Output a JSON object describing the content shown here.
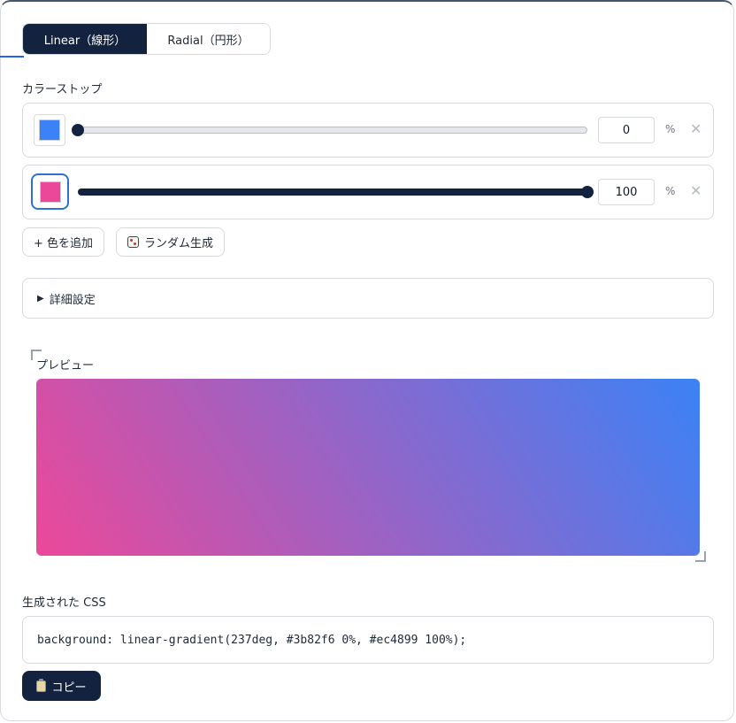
{
  "tabs": {
    "linear_label": "Linear（線形）",
    "radial_label": "Radial（円形）",
    "active": "linear"
  },
  "color_stops": {
    "heading": "カラーストップ",
    "unit": "%",
    "remove_symbol": "✕",
    "stops": [
      {
        "color": "#3b82f6",
        "position": "0",
        "position_fraction": 0.0,
        "focused": false
      },
      {
        "color": "#ec4899",
        "position": "100",
        "position_fraction": 1.0,
        "focused": true
      }
    ]
  },
  "actions": {
    "add_color_label": "+ 色を追加",
    "random_label": "ランダム生成",
    "random_icon": "dice-icon"
  },
  "details": {
    "toggle_symbol": "▶",
    "label": "詳細設定"
  },
  "preview": {
    "heading": "プレビュー",
    "angle_deg": 237
  },
  "css_output": {
    "heading": "生成された CSS",
    "code": "background: linear-gradient(237deg, #3b82f6 0%, #ec4899 100%);",
    "copy_label": "コピー",
    "copy_icon": "clipboard-icon"
  },
  "colors": {
    "primary_dark": "#13233f",
    "accent_blue": "#2563eb",
    "border": "#d7dbe0"
  }
}
